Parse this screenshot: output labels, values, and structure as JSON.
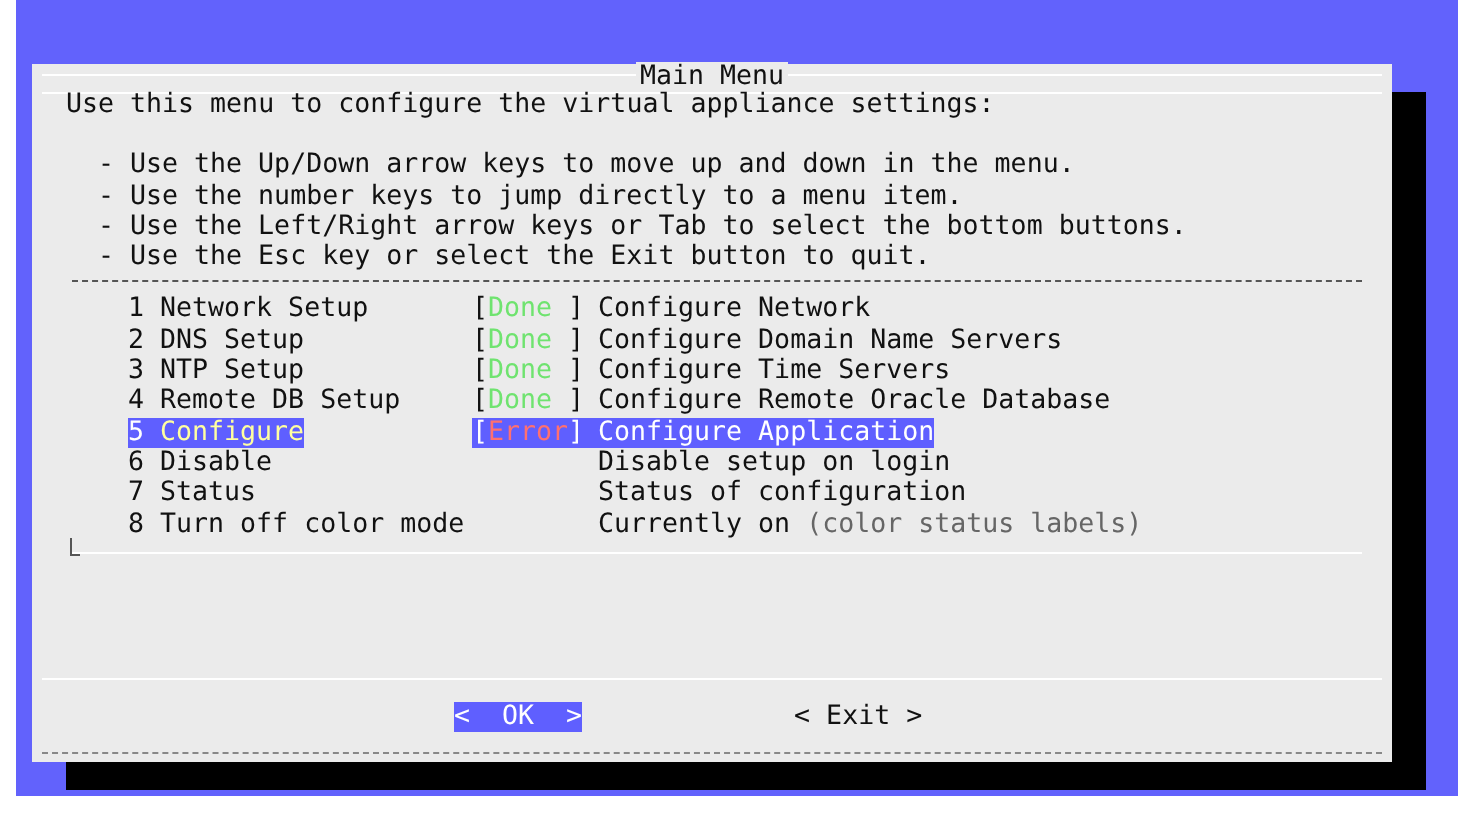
{
  "dialog": {
    "title": "Main Menu",
    "intro": "Use this menu to configure the virtual appliance settings:",
    "hints": [
      "- Use the Up/Down arrow keys to move up and down in the menu.",
      "- Use the number keys to jump directly to a menu item.",
      "- Use the Left/Right arrow keys or Tab to select the bottom buttons.",
      "- Use the Esc key or select the Exit button to quit."
    ]
  },
  "menu": {
    "status_open": "[",
    "status_close": "]",
    "items": [
      {
        "number": "1",
        "name": "Network Setup",
        "status": "Done",
        "kind": "done",
        "description": "Configure Network",
        "selected": false
      },
      {
        "number": "2",
        "name": "DNS Setup",
        "status": "Done",
        "kind": "done",
        "description": "Configure Domain Name Servers",
        "selected": false
      },
      {
        "number": "3",
        "name": "NTP Setup",
        "status": "Done",
        "kind": "done",
        "description": "Configure Time Servers",
        "selected": false
      },
      {
        "number": "4",
        "name": "Remote DB Setup",
        "status": "Done",
        "kind": "done",
        "description": "Configure Remote Oracle Database",
        "selected": false
      },
      {
        "number": "5",
        "name": "Configure",
        "status": "Error",
        "kind": "error",
        "description": "Configure Application",
        "selected": true
      },
      {
        "number": "6",
        "name": "Disable",
        "kind": "plain",
        "description": "Disable setup on login",
        "selected": false
      },
      {
        "number": "7",
        "name": "Status",
        "kind": "plain",
        "description": "Status of configuration",
        "selected": false
      },
      {
        "number": "8",
        "name": "Turn off color mode",
        "kind": "plain",
        "description": "Currently on",
        "note": "(color status labels)",
        "selected": false
      }
    ]
  },
  "buttons": [
    {
      "label": "<  OK  >",
      "selected": true
    },
    {
      "label": "< Exit >",
      "selected": false
    }
  ]
}
